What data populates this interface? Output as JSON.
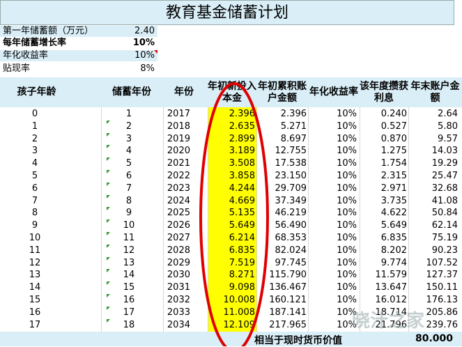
{
  "sheet_title": "教育基金储蓄计划",
  "params": [
    {
      "label": "第一年储蓄额（万元）",
      "value": "2.40",
      "bold": false,
      "bg": "#d9eef7"
    },
    {
      "label": "每年储蓄增长率",
      "value": "10%",
      "bold": true,
      "bg": "#ffffff"
    },
    {
      "label": "年化收益率",
      "value": "10%",
      "bold": false,
      "bg": "#d9eef7"
    },
    {
      "label": "贴现率",
      "value": "8%",
      "bold": false,
      "bg": "#ffffff"
    }
  ],
  "headers": [
    "孩子年龄",
    "储蓄年份",
    "年份",
    "年初新投入本金",
    "年初累积账户金额",
    "年化收益率",
    "该年度攒获利息",
    "年末账户金额"
  ],
  "rows": [
    [
      "0",
      "1",
      "2017",
      "2.396",
      "2.396",
      "10%",
      "0.240",
      "2.64"
    ],
    [
      "1",
      "2",
      "2018",
      "2.635",
      "5.271",
      "10%",
      "0.527",
      "5.80"
    ],
    [
      "2",
      "3",
      "2019",
      "2.899",
      "8.697",
      "10%",
      "0.870",
      "9.57"
    ],
    [
      "3",
      "4",
      "2020",
      "3.189",
      "12.755",
      "10%",
      "1.275",
      "14.03"
    ],
    [
      "4",
      "5",
      "2021",
      "3.508",
      "17.538",
      "10%",
      "1.754",
      "19.29"
    ],
    [
      "5",
      "6",
      "2022",
      "3.858",
      "23.150",
      "10%",
      "2.315",
      "25.47"
    ],
    [
      "6",
      "7",
      "2023",
      "4.244",
      "29.709",
      "10%",
      "2.971",
      "32.68"
    ],
    [
      "7",
      "8",
      "2024",
      "4.669",
      "37.349",
      "10%",
      "3.735",
      "41.08"
    ],
    [
      "8",
      "9",
      "2025",
      "5.135",
      "46.219",
      "10%",
      "4.622",
      "50.84"
    ],
    [
      "9",
      "10",
      "2026",
      "5.649",
      "56.490",
      "10%",
      "5.649",
      "62.14"
    ],
    [
      "10",
      "11",
      "2027",
      "6.214",
      "68.353",
      "10%",
      "6.835",
      "75.19"
    ],
    [
      "11",
      "12",
      "2028",
      "6.835",
      "82.024",
      "10%",
      "8.202",
      "90.23"
    ],
    [
      "12",
      "13",
      "2029",
      "7.519",
      "97.745",
      "10%",
      "9.774",
      "107.52"
    ],
    [
      "13",
      "14",
      "2030",
      "8.271",
      "115.790",
      "10%",
      "11.579",
      "127.37"
    ],
    [
      "14",
      "15",
      "2031",
      "9.098",
      "136.467",
      "10%",
      "13.647",
      "150.11"
    ],
    [
      "15",
      "16",
      "2032",
      "10.008",
      "160.121",
      "10%",
      "16.012",
      "176.13"
    ],
    [
      "16",
      "17",
      "2033",
      "11.008",
      "187.141",
      "10%",
      "18.714",
      "205.86"
    ],
    [
      "17",
      "18",
      "2034",
      "12.109",
      "217.965",
      "10%",
      "21.796",
      "239.76"
    ]
  ],
  "footer": {
    "label": "相当于现时货币价值",
    "value": "80.000"
  },
  "watermark": "晓汁之家",
  "colors": {
    "header_bg": "#d9eef7",
    "highlight": "#ffff00",
    "ellipse": "#e00000",
    "flag": "#2e9b2e"
  }
}
